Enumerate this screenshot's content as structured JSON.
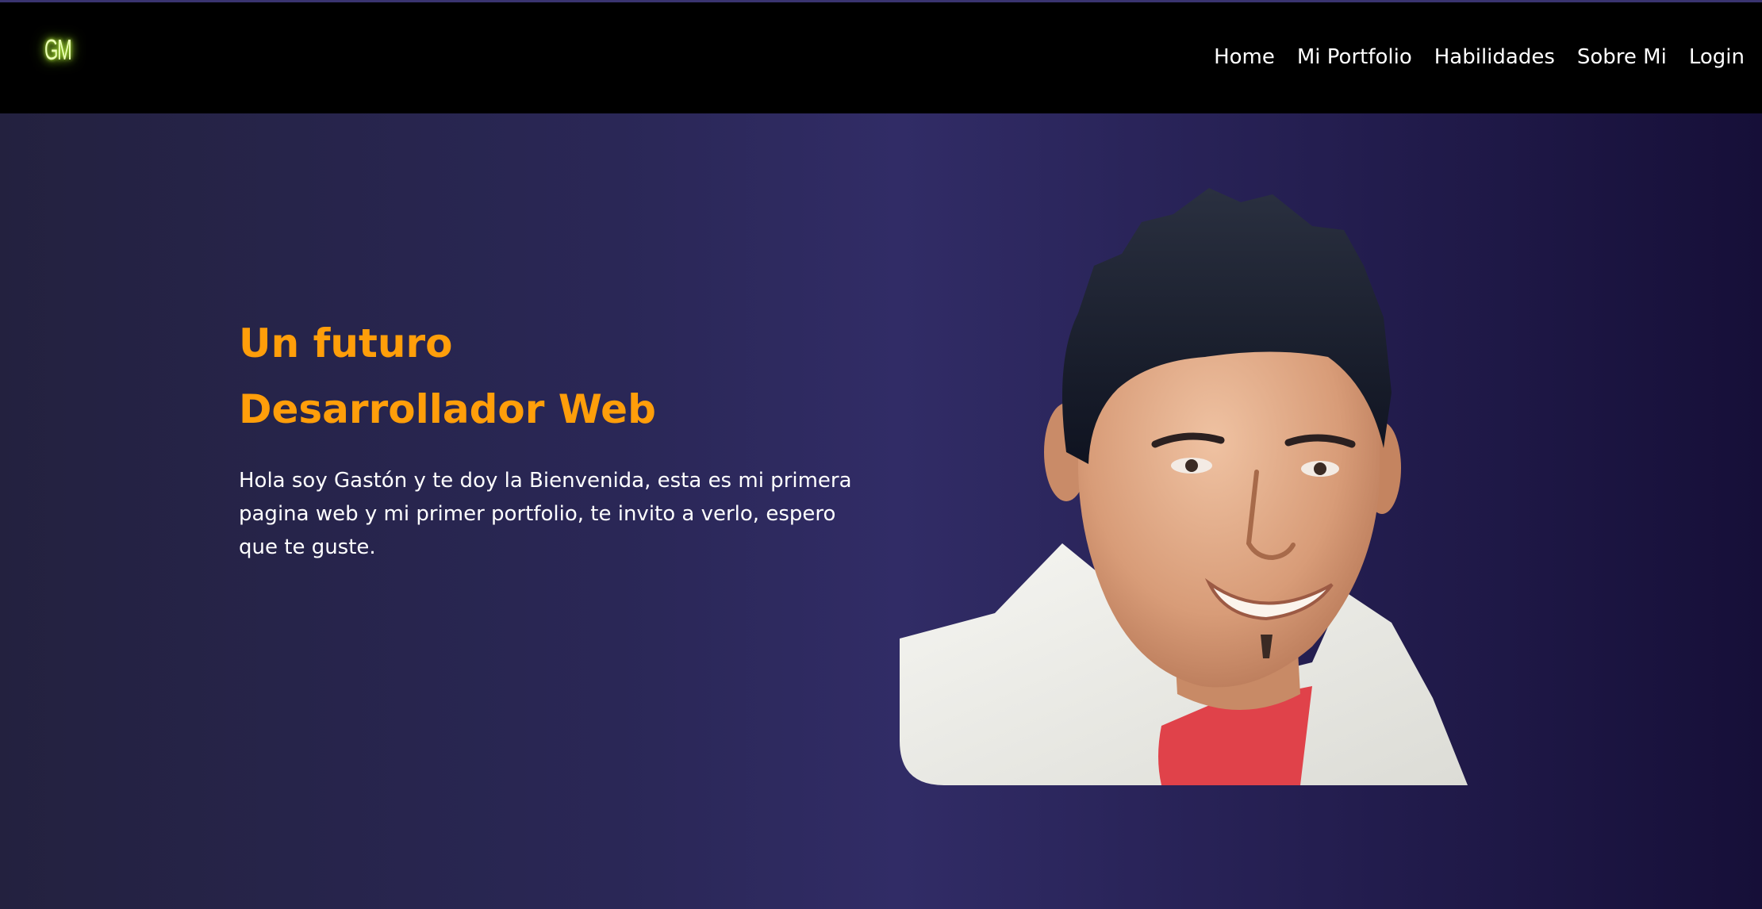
{
  "logo": {
    "text": "GM",
    "color": "#c8ff3c"
  },
  "nav": {
    "items": [
      {
        "label": "Home"
      },
      {
        "label": "Mi Portfolio"
      },
      {
        "label": "Habilidades"
      },
      {
        "label": "Sobre Mi"
      },
      {
        "label": "Login"
      }
    ]
  },
  "hero": {
    "title_line1": "Un futuro",
    "title_line2": "Desarrollador Web",
    "description": "Hola soy Gastón y te doy la Bienvenida, esta es mi primera pagina web y mi primer portfolio, te invito a verlo, espero que te guste.",
    "title_color": "#ff9e0a"
  }
}
